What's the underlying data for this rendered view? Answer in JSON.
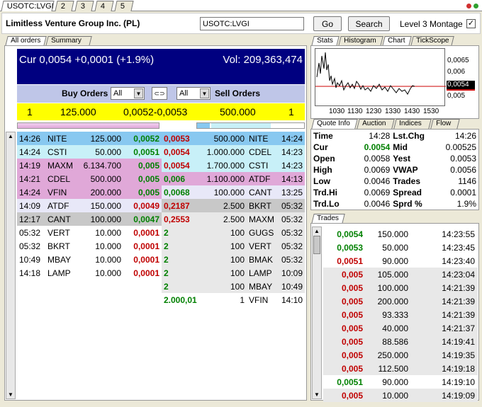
{
  "top_tabs": [
    {
      "label": "USOTC:LVGI",
      "active": true
    },
    {
      "label": "2"
    },
    {
      "label": "3"
    },
    {
      "label": "4"
    },
    {
      "label": "5"
    }
  ],
  "header": {
    "company": "Limitless Venture Group Inc. (PL)",
    "symbol": "USOTC:LVGI",
    "go": "Go",
    "search": "Search",
    "montage": "Level 3 Montage",
    "montage_checked": "✓"
  },
  "left_tabs": [
    "All orders",
    "Summary"
  ],
  "quote": {
    "cur": "Cur 0,0054 +0,0001 (+1.9%)",
    "vol": "Vol: 209,363,474"
  },
  "orders_bar": {
    "buy_label": "Buy Orders",
    "buy_filter": "All",
    "sell_filter": "All",
    "sell_label": "Sell Orders",
    "link_icon": "⊂⊃"
  },
  "summary": {
    "bid_count": "1",
    "bid_size": "125.000",
    "spread": "0,0052-0,0053",
    "ask_size": "500.000",
    "ask_count": "1"
  },
  "bids": [
    {
      "time": "14:26",
      "mm": "NITE",
      "size": "125.000",
      "price": "0,0052",
      "color": "#88c8f0",
      "pc": "green"
    },
    {
      "time": "14:24",
      "mm": "CSTI",
      "size": "50.000",
      "price": "0,0051",
      "color": "#c8f0f8",
      "pc": "green"
    },
    {
      "time": "14:19",
      "mm": "MAXM",
      "size": "6.134.700",
      "price": "0,005",
      "color": "#e0a8d8",
      "pc": "green"
    },
    {
      "time": "14:21",
      "mm": "CDEL",
      "size": "500.000",
      "price": "0,005",
      "color": "#e0a8d8",
      "pc": "green"
    },
    {
      "time": "14:24",
      "mm": "VFIN",
      "size": "200.000",
      "price": "0,005",
      "color": "#e0a8d8",
      "pc": "green"
    },
    {
      "time": "14:09",
      "mm": "ATDF",
      "size": "150.000",
      "price": "0,0049",
      "color": "#e8e8f8",
      "pc": "red"
    },
    {
      "time": "12:17",
      "mm": "CANT",
      "size": "100.000",
      "price": "0,0047",
      "color": "#c8c8c8",
      "pc": "green"
    },
    {
      "time": "05:32",
      "mm": "VERT",
      "size": "10.000",
      "price": "0,0001",
      "color": "#ffffff",
      "pc": "red"
    },
    {
      "time": "05:32",
      "mm": "BKRT",
      "size": "10.000",
      "price": "0,0001",
      "color": "#ffffff",
      "pc": "red"
    },
    {
      "time": "10:49",
      "mm": "MBAY",
      "size": "10.000",
      "price": "0,0001",
      "color": "#ffffff",
      "pc": "red"
    },
    {
      "time": "14:18",
      "mm": "LAMP",
      "size": "10.000",
      "price": "0,0001",
      "color": "#ffffff",
      "pc": "red"
    }
  ],
  "asks": [
    {
      "price": "0,0053",
      "size": "500.000",
      "mm": "NITE",
      "time": "14:24",
      "color": "#88c8f0",
      "pc": "red"
    },
    {
      "price": "0,0054",
      "size": "1.000.000",
      "mm": "CDEL",
      "time": "14:23",
      "color": "#c8f0f8",
      "pc": "red"
    },
    {
      "price": "0,0054",
      "size": "1.700.000",
      "mm": "CSTI",
      "time": "14:23",
      "color": "#c8f0f8",
      "pc": "red"
    },
    {
      "price": "0,006",
      "size": "1.100.000",
      "mm": "ATDF",
      "time": "14:13",
      "color": "#e0a8d8",
      "pc": "green"
    },
    {
      "price": "0,0068",
      "size": "100.000",
      "mm": "CANT",
      "time": "13:25",
      "color": "#e8e8f8",
      "pc": "green"
    },
    {
      "price": "0,2187",
      "size": "2.500",
      "mm": "BKRT",
      "time": "05:32",
      "color": "#c8c8c8",
      "pc": "red"
    },
    {
      "price": "0,2553",
      "size": "2.500",
      "mm": "MAXM",
      "time": "05:32",
      "color": "#e8e8e8",
      "pc": "red"
    },
    {
      "price": "2",
      "size": "100",
      "mm": "GUGS",
      "time": "05:32",
      "color": "#e8e8e8",
      "pc": "green"
    },
    {
      "price": "2",
      "size": "100",
      "mm": "VERT",
      "time": "05:32",
      "color": "#e8e8e8",
      "pc": "green"
    },
    {
      "price": "2",
      "size": "100",
      "mm": "BMAK",
      "time": "05:32",
      "color": "#e8e8e8",
      "pc": "green"
    },
    {
      "price": "2",
      "size": "100",
      "mm": "LAMP",
      "time": "10:09",
      "color": "#e8e8e8",
      "pc": "green"
    },
    {
      "price": "2",
      "size": "100",
      "mm": "MBAY",
      "time": "10:49",
      "color": "#e8e8e8",
      "pc": "green"
    },
    {
      "price": "2.000,01",
      "size": "1",
      "mm": "VFIN",
      "time": "14:10",
      "color": "#ffffff",
      "pc": "green"
    }
  ],
  "chart_tabs": [
    "Stats",
    "Histogram",
    "Chart",
    "TickScope"
  ],
  "chart": {
    "yticks": [
      "0,0065",
      "0,006",
      "0,0054",
      "0,005"
    ],
    "xticks": [
      "1030",
      "1130",
      "1230",
      "1330",
      "1430",
      "1530"
    ],
    "accent": "#cc0000"
  },
  "info_tabs": [
    "Quote Info",
    "Auction",
    "Indices",
    "Flow"
  ],
  "quote_info": [
    {
      "l1": "Time",
      "v1": "14:28",
      "l2": "Lst.Chg",
      "v2": "14:26"
    },
    {
      "l1": "Cur",
      "v1": "0.0054",
      "l2": "Mid",
      "v2": "0.00525"
    },
    {
      "l1": "Open",
      "v1": "0.0058",
      "l2": "Yest",
      "v2": "0.0053"
    },
    {
      "l1": "High",
      "v1": "0.0069",
      "l2": "VWAP",
      "v2": "0.0056"
    },
    {
      "l1": "Low",
      "v1": "0.0046",
      "l2": "Trades",
      "v2": "1146"
    },
    {
      "l1": "Trd.Hi",
      "v1": "0.0069",
      "l2": "Spread",
      "v2": "0.0001"
    },
    {
      "l1": "Trd.Lo",
      "v1": "0.0046",
      "l2": "Sprd %",
      "v2": "1.9%"
    }
  ],
  "trades_tab": "Trades",
  "trades": [
    {
      "price": "0,0054",
      "size": "150.000",
      "time": "14:23:55",
      "pc": "green",
      "bg": "#ffffff"
    },
    {
      "price": "0,0053",
      "size": "50.000",
      "time": "14:23:45",
      "pc": "green",
      "bg": "#ffffff"
    },
    {
      "price": "0,0051",
      "size": "90.000",
      "time": "14:23:40",
      "pc": "red",
      "bg": "#ffffff"
    },
    {
      "price": "0,005",
      "size": "105.000",
      "time": "14:23:04",
      "pc": "red",
      "bg": "#e8e8e8"
    },
    {
      "price": "0,005",
      "size": "100.000",
      "time": "14:21:39",
      "pc": "red",
      "bg": "#e8e8e8"
    },
    {
      "price": "0,005",
      "size": "200.000",
      "time": "14:21:39",
      "pc": "red",
      "bg": "#e8e8e8"
    },
    {
      "price": "0,005",
      "size": "93.333",
      "time": "14:21:39",
      "pc": "red",
      "bg": "#e8e8e8"
    },
    {
      "price": "0,005",
      "size": "40.000",
      "time": "14:21:37",
      "pc": "red",
      "bg": "#e8e8e8"
    },
    {
      "price": "0,005",
      "size": "88.586",
      "time": "14:19:41",
      "pc": "red",
      "bg": "#e8e8e8"
    },
    {
      "price": "0,005",
      "size": "250.000",
      "time": "14:19:35",
      "pc": "red",
      "bg": "#e8e8e8"
    },
    {
      "price": "0,005",
      "size": "112.500",
      "time": "14:19:18",
      "pc": "red",
      "bg": "#e8e8e8"
    },
    {
      "price": "0,0051",
      "size": "90.000",
      "time": "14:19:10",
      "pc": "green",
      "bg": "#ffffff"
    },
    {
      "price": "0,005",
      "size": "10.000",
      "time": "14:19:09",
      "pc": "red",
      "bg": "#e8e8e8"
    }
  ]
}
